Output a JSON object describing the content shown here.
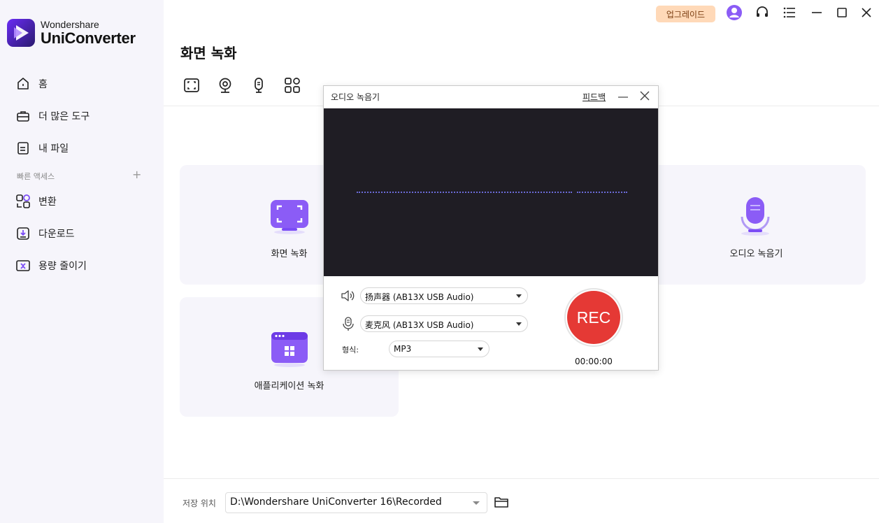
{
  "app": {
    "brand_small": "Wondershare",
    "brand_big": "UniConverter"
  },
  "sidebar": {
    "items": [
      {
        "label": "홈",
        "icon": "home-icon"
      },
      {
        "label": "더 많은 도구",
        "icon": "toolbox-icon"
      },
      {
        "label": "내 파일",
        "icon": "file-icon"
      }
    ],
    "quick_access_title": "빠른 액세스",
    "quick_add": "+",
    "quick_items": [
      {
        "label": "변환",
        "icon": "convert-icon"
      },
      {
        "label": "다운로드",
        "icon": "download-icon"
      },
      {
        "label": "용량 줄이기",
        "icon": "compress-icon"
      }
    ]
  },
  "topbar": {
    "upgrade_label": "업그레이드"
  },
  "main": {
    "title": "화면 녹화",
    "cards": [
      {
        "label": "화면 녹화"
      },
      {
        "label": "오디오 녹음기"
      },
      {
        "label": "애플리케이션 녹화"
      }
    ],
    "save_location_label": "저장 위치",
    "save_location_value": "D:\\Wondershare UniConverter 16\\Recorded"
  },
  "dialog": {
    "title": "오디오 녹음기",
    "feedback_label": "피드백",
    "speaker_device": "扬声器 (AB13X USB Audio)",
    "mic_device": "麦克风 (AB13X USB Audio)",
    "format_label": "형식:",
    "format_value": "MP3",
    "rec_label": "REC",
    "timer": "00:00:00"
  },
  "colors": {
    "accent": "#7b4cf5",
    "rec": "#e53935",
    "upgrade_bg": "#ffd9b8",
    "sidebar_bg": "#f6f5fb",
    "waveform_bg": "#1f1d24"
  }
}
